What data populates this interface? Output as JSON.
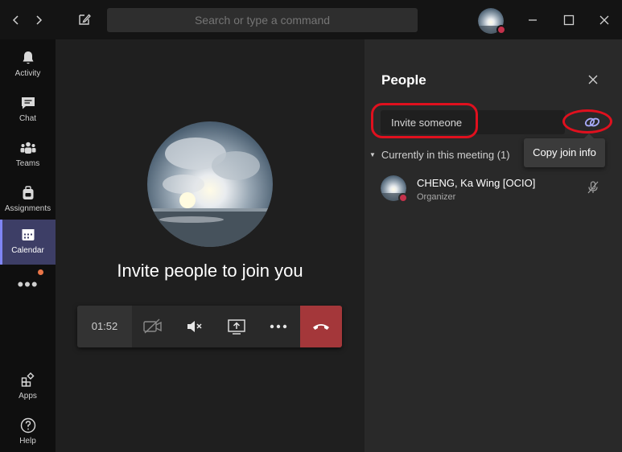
{
  "titlebar": {
    "search_placeholder": "Search or type a command",
    "back_icon": "chevron-left-icon",
    "forward_icon": "chevron-right-icon",
    "compose_icon": "compose-icon"
  },
  "rail": {
    "items": [
      {
        "label": "Activity",
        "icon": "bell-icon"
      },
      {
        "label": "Chat",
        "icon": "chat-icon"
      },
      {
        "label": "Teams",
        "icon": "teams-icon"
      },
      {
        "label": "Assignments",
        "icon": "backpack-icon"
      },
      {
        "label": "Calendar",
        "icon": "calendar-icon"
      },
      {
        "label": "Apps",
        "icon": "apps-icon"
      },
      {
        "label": "Help",
        "icon": "help-icon"
      }
    ],
    "active": "Calendar",
    "more_label": "•••"
  },
  "stage": {
    "invite_text": "Invite people to join you",
    "timer": "01:52"
  },
  "panel": {
    "title": "People",
    "invite_placeholder": "Invite someone",
    "tooltip": "Copy join info",
    "section_label": "Currently in this meeting (1)",
    "participants": [
      {
        "name": "CHENG, Ka Wing [OCIO]",
        "role": "Organizer"
      }
    ]
  },
  "colors": {
    "accent": "#7f85f5",
    "hangup": "#a4373a",
    "status_busy": "#c4314b",
    "annotation": "#e0101e"
  }
}
